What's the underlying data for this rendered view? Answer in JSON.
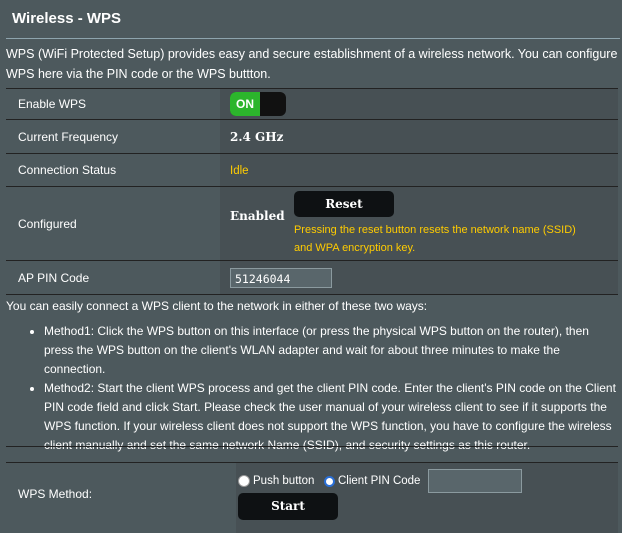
{
  "header": {
    "title": "Wireless - WPS"
  },
  "intro": "WPS (WiFi Protected Setup) provides easy and secure establishment of a wireless network. You can configure WPS here via the PIN code or the WPS buttton.",
  "rows": {
    "enable_wps": {
      "label": "Enable WPS",
      "toggle": "ON"
    },
    "frequency": {
      "label": "Current Frequency",
      "value": "2.4 GHz"
    },
    "connection": {
      "label": "Connection Status",
      "value": "Idle"
    },
    "configured": {
      "label": "Configured",
      "value": "Enabled",
      "button": "Reset",
      "note": "Pressing the reset button resets the network name (SSID) and WPA encryption key."
    },
    "ap_pin": {
      "label": "AP PIN Code",
      "value": "51246044"
    }
  },
  "ways": {
    "intro": "You can easily connect a WPS client to the network in either of these two ways:",
    "method1": "Method1: Click the WPS button on this interface (or press the physical WPS button on the router), then press the WPS button on the client's WLAN adapter and wait for about three minutes to make the connection.",
    "method2": "Method2: Start the client WPS process and get the client PIN code. Enter the client's PIN code on the Client PIN code field and click Start. Please check the user manual of your wireless client to see if it supports the WPS function. If your wireless client does not support the WPS function, you have to configure the wireless client manually and set the same network Name (SSID), and security settings as this router."
  },
  "wps_method": {
    "label": "WPS Method:",
    "option_push": "Push button",
    "option_pin": "Client PIN Code",
    "selected": "Client PIN Code",
    "pin_value": "",
    "start": "Start"
  },
  "colors": {
    "on": "#2cb52c",
    "status": "#ffcc00",
    "background": "#4d595d"
  }
}
